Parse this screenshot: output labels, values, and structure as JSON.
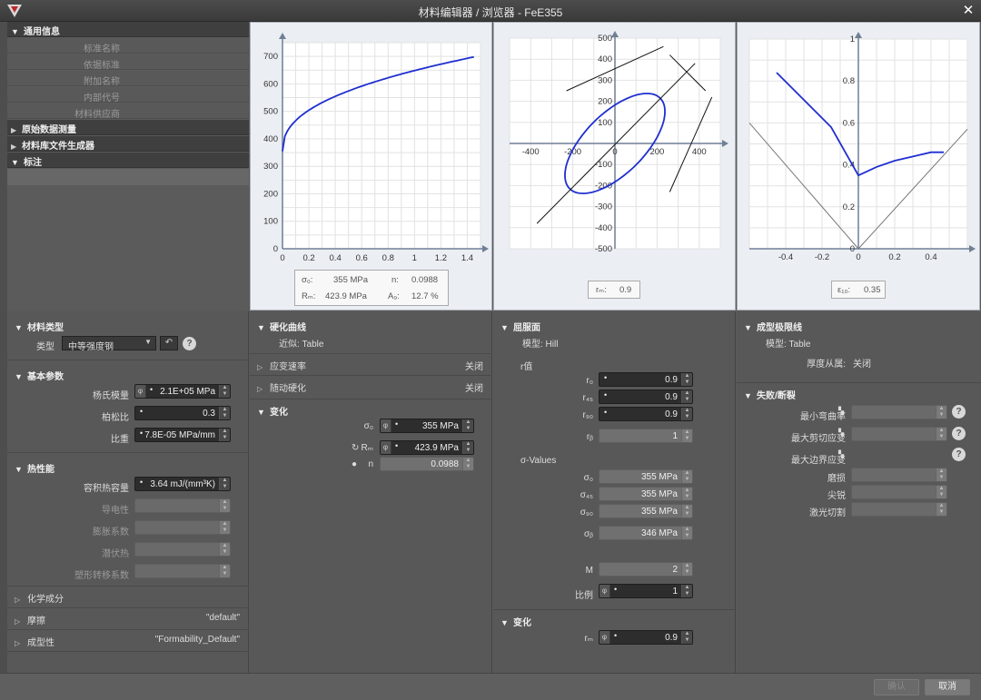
{
  "window": {
    "title": "材料编辑器 / 浏览器 - FeE355"
  },
  "general_info": {
    "header": "通用信息",
    "rows": [
      "标准名称",
      "依据标准",
      "附加名称",
      "内部代号",
      "材料供应商"
    ]
  },
  "tree_sections": [
    {
      "label": "原始数据测量",
      "expanded": false
    },
    {
      "label": "材料库文件生成器",
      "expanded": false
    },
    {
      "label": "标注",
      "expanded": true
    }
  ],
  "plot1": {
    "x_ticks": [
      "0",
      "0.2",
      "0.4",
      "0.6",
      "0.8",
      "1",
      "1.2",
      "1.4"
    ],
    "y_ticks": [
      "0",
      "100",
      "200",
      "300",
      "400",
      "500",
      "600",
      "700"
    ],
    "readout": {
      "sigma0_label": "σ₀:",
      "sigma0_value": "355 MPa",
      "n_label": "n:",
      "n_value": "0.0988",
      "rm_label": "Rₘ:",
      "rm_value": "423.9 MPa",
      "ag_label": "A₉:",
      "ag_value": "12.7 %"
    }
  },
  "plot2": {
    "x_ticks": [
      "-400",
      "-200",
      "0",
      "200",
      "400"
    ],
    "y_ticks": [
      "500",
      "400",
      "300",
      "200",
      "100",
      "-100",
      "-200",
      "-300",
      "-400",
      "-500"
    ],
    "readout": {
      "label": "rₘ:",
      "value": "0.9"
    }
  },
  "plot3": {
    "x_ticks": [
      "-0.4",
      "-0.2",
      "0",
      "0.2",
      "0.4"
    ],
    "y_ticks": [
      "1",
      "0.8",
      "0.6",
      "0.4",
      "0.2",
      "0"
    ],
    "readout": {
      "label": "ε₁₀:",
      "value": "0.35"
    }
  },
  "chart_data": [
    {
      "type": "line",
      "x": [
        0,
        0.02,
        0.05,
        0.1,
        0.2,
        0.3,
        0.4,
        0.6,
        0.8,
        1.0,
        1.2,
        1.45
      ],
      "series": [
        {
          "values": [
            355,
            430,
            470,
            510,
            555,
            585,
            605,
            635,
            655,
            670,
            683,
            698
          ]
        }
      ],
      "xlim": [
        0,
        1.5
      ],
      "ylim": [
        0,
        750
      ],
      "grid": true
    },
    {
      "type": "line",
      "series": [
        {
          "values": "ellipse yield locus"
        }
      ],
      "xlim": [
        -500,
        500
      ],
      "ylim": [
        -500,
        500
      ],
      "grid": true
    },
    {
      "type": "line",
      "x": [
        -0.45,
        -0.3,
        -0.15,
        0,
        0.1,
        0.2,
        0.3,
        0.4,
        0.47
      ],
      "series": [
        {
          "values": [
            0.84,
            0.71,
            0.58,
            0.35,
            0.39,
            0.42,
            0.44,
            0.46,
            0.46
          ]
        }
      ],
      "xlim": [
        -0.6,
        0.6
      ],
      "ylim": [
        0,
        1
      ],
      "grid": true
    }
  ],
  "material_type": {
    "header": "材料类型",
    "type_label": "类型",
    "type_value": "中等强度钢"
  },
  "basic_params": {
    "header": "基本参数",
    "youngs_label": "杨氏模量",
    "youngs_value": "2.1E+05 MPa",
    "poisson_label": "柏松比",
    "poisson_value": "0.3",
    "density_label": "比重",
    "density_value": "7.8E-05 MPa/mm"
  },
  "thermal": {
    "header": "热性能",
    "heatcap_label": "容积热容量",
    "heatcap_value": "3.64 mJ/(mm³K)",
    "rows": [
      "导电性",
      "膨胀系数",
      "潜伏热",
      "塑形转移系数"
    ]
  },
  "bottom_left": [
    {
      "label": "化学成分",
      "value": ""
    },
    {
      "label": "摩擦",
      "value": "\"default\""
    },
    {
      "label": "成型性",
      "value": "\"Formability_Default\""
    }
  ],
  "hardening": {
    "header": "硬化曲线",
    "approx": "近似: Table",
    "strain_rate": {
      "label": "应变速率",
      "value": "关闭"
    },
    "kinematic": {
      "label": "随动硬化",
      "value": "关闭"
    },
    "change_header": "变化",
    "sigma0_label": "σ₀",
    "sigma0_value": "355 MPa",
    "rm_label": "Rₘ",
    "rm_value": "423.9 MPa",
    "n_label": "n",
    "n_value": "0.0988"
  },
  "yield_surface": {
    "header": "屈服面",
    "model": "模型: Hill",
    "r_header": "r值",
    "r0_label": "r₀",
    "r0_value": "0.9",
    "r45_label": "r₄₅",
    "r45_value": "0.9",
    "r90_label": "r₉₀",
    "r90_value": "0.9",
    "rb_label": "rᵦ",
    "rb_value": "1",
    "sigma_header": "σ-Values",
    "s0_label": "σ₀",
    "s0_value": "355 MPa",
    "s45_label": "σ₄₅",
    "s45_value": "355 MPa",
    "s90_label": "σ₉₀",
    "s90_value": "355 MPa",
    "sb_label": "σᵦ",
    "sb_value": "346 MPa",
    "m_label": "M",
    "m_value": "2",
    "ratio_label": "比例",
    "ratio_value": "1",
    "change_header": "变化",
    "rm_label": "rₘ",
    "rm_value": "0.9"
  },
  "forming_limit": {
    "header": "成型极限线",
    "model": "模型: Table",
    "thickness_label": "厚度从属:",
    "thickness_value": "关闭"
  },
  "failure": {
    "header": "失败/断裂",
    "min_bend_label": "最小弯曲率",
    "max_shear_label": "最大剪切应变",
    "max_edge_label": "最大边界应变",
    "edge_rows": [
      "磨损",
      "尖锐",
      "激光切割"
    ]
  },
  "footer": {
    "ok_label": "确认",
    "cancel_label": "取消"
  }
}
